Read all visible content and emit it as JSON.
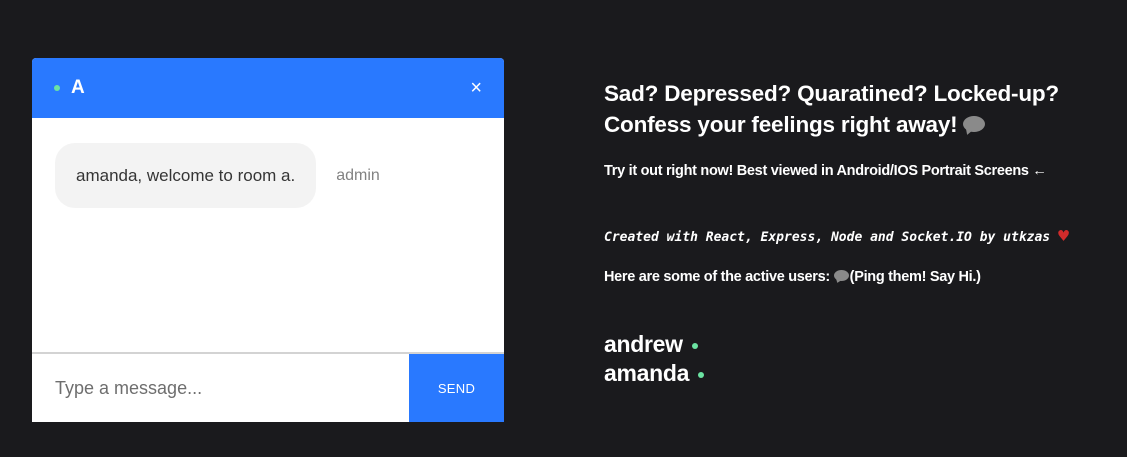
{
  "chat": {
    "room_name": "A",
    "close_label": "×",
    "messages": [
      {
        "text": "amanda, welcome to room a.",
        "sender": "admin"
      }
    ],
    "input_placeholder": "Type a message...",
    "input_value": "",
    "send_label": "SEND"
  },
  "info": {
    "headline_line1": "Sad? Depressed? Quaratined? Locked-up?",
    "headline_line2": "Confess your feelings right away!",
    "tagline": "Try it out right now! Best viewed in Android/IOS Portrait Screens ←",
    "credits": "Created with React, Express, Node and Socket.IO by utkzas",
    "active_users_prefix": "Here are some of the active users:",
    "active_users_suffix": "(Ping them! Say Hi.)",
    "heart": "♥"
  },
  "active_users": [
    {
      "name": "andrew"
    },
    {
      "name": "amanda"
    }
  ],
  "colors": {
    "background": "#1a1a1d",
    "accent": "#2979ff",
    "online": "#6be3a2",
    "heart": "#d12b2b"
  },
  "icons": {
    "online_indicator": "online-dot-icon",
    "close": "close-icon",
    "speech_bubble": "speech-bubble-icon",
    "heart": "heart-icon"
  }
}
